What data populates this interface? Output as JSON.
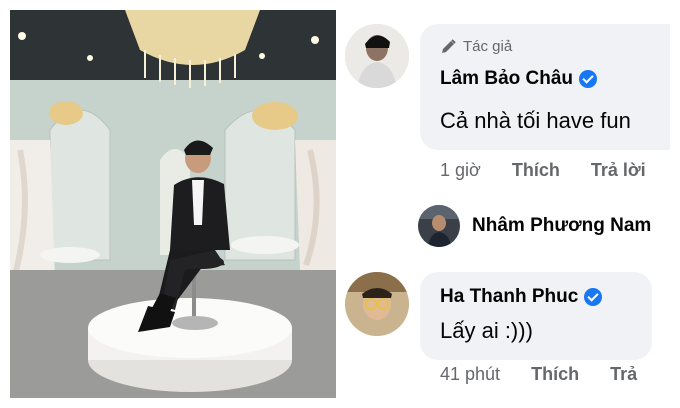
{
  "comments": [
    {
      "author_tag": "Tác giả",
      "author": "Lâm Bảo Châu",
      "verified": true,
      "text": "Cả nhà tối have fun",
      "time": "1 giờ",
      "like": "Thích",
      "reply": "Trả lời"
    },
    {
      "author": "Ha Thanh Phuc",
      "verified": true,
      "text": "Lấy ai :)))",
      "time": "41 phút",
      "like": "Thích",
      "reply": "Trả"
    }
  ],
  "reply_thread": {
    "author": "Nhâm Phương Nam"
  },
  "icons": {
    "author_tag": "pencil-icon",
    "verified": "verified-badge-icon"
  },
  "colors": {
    "bubble_bg": "#f0f2f5",
    "verified_blue": "#1877f2",
    "meta_gray": "#65676b"
  }
}
